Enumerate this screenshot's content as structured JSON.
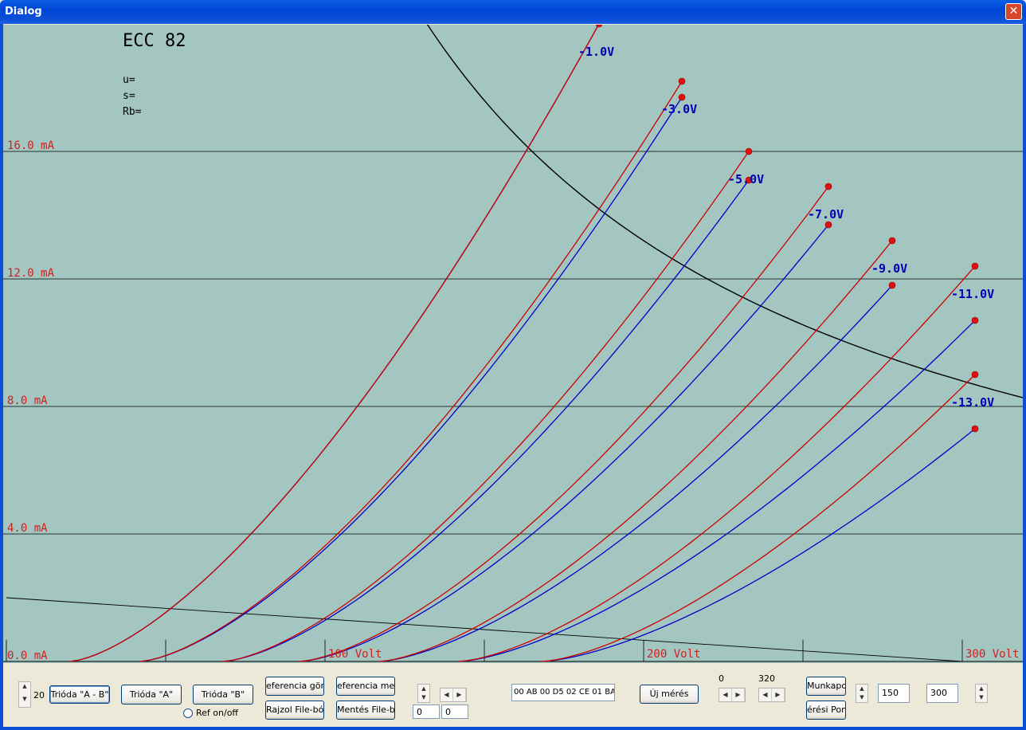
{
  "window": {
    "title": "Dialog",
    "close_glyph": "✕"
  },
  "chart_data": {
    "type": "line",
    "title": "ECC 82",
    "params": [
      "u=",
      "s=",
      "Rb="
    ],
    "xlabel": "",
    "ylabel": "",
    "xlim": [
      0,
      320
    ],
    "ylim": [
      0,
      20
    ],
    "x_ticks": [
      {
        "v": 0,
        "label": ""
      },
      {
        "v": 50,
        "label": ""
      },
      {
        "v": 100,
        "label": "100 Volt"
      },
      {
        "v": 150,
        "label": ""
      },
      {
        "v": 200,
        "label": "200 Volt"
      },
      {
        "v": 250,
        "label": ""
      },
      {
        "v": 300,
        "label": "300 Volt"
      }
    ],
    "y_ticks": [
      {
        "v": 0,
        "label": "0.0 mA"
      },
      {
        "v": 4,
        "label": "4.0 mA"
      },
      {
        "v": 8,
        "label": "8.0 mA"
      },
      {
        "v": 12,
        "label": "12.0 mA"
      },
      {
        "v": 16,
        "label": "16.0 mA"
      }
    ],
    "grid": "horizontal",
    "series_colors": {
      "A": "#cc0000",
      "B": "#0000c8"
    },
    "curves": [
      {
        "grid_label": "-1.0V",
        "start": 20,
        "end": 186,
        "a_end": 20.0,
        "b_end": 20.0
      },
      {
        "grid_label": "-3.0V",
        "start": 42,
        "end": 212,
        "a_end": 18.2,
        "b_end": 17.7
      },
      {
        "grid_label": "-5.0V",
        "start": 68,
        "end": 233,
        "a_end": 16.0,
        "b_end": 15.1
      },
      {
        "grid_label": "-7.0V",
        "start": 92,
        "end": 258,
        "a_end": 14.9,
        "b_end": 13.7
      },
      {
        "grid_label": "-9.0V",
        "start": 117,
        "end": 278,
        "a_end": 13.2,
        "b_end": 11.8
      },
      {
        "grid_label": "-11.0V",
        "start": 142,
        "end": 304,
        "a_end": 12.4,
        "b_end": 10.7
      },
      {
        "grid_label": "-13.0V",
        "start": 168,
        "end": 304,
        "a_end": 9.0,
        "b_end": 7.3
      }
    ],
    "load_line": {
      "from": [
        0,
        2.0
      ],
      "to": [
        300,
        0.0
      ]
    },
    "hyperbola_k": 2640
  },
  "controls": {
    "spin_value": "20",
    "btn_trioda_ab": "Trióda \"A - B\"",
    "btn_trioda_a": "Trióda  \"A\"",
    "btn_trioda_b": "Trióda  \"B\"",
    "ref_radio": "Ref on/off",
    "btn_ref_curve": "eferencia görb",
    "btn_draw_file": "Rajzol File-ból",
    "btn_ref_save": "eferencia mentr",
    "btn_save_file": "Mentés File-ba",
    "field_left_1": "0",
    "field_left_2": "0",
    "hex_data": "00 AB 00 D5 02 CE 01 BA",
    "btn_new_measure": "Új mérés",
    "range_low": "0",
    "range_high": "320",
    "btn_work_point": "Munkapon",
    "btn_measure_point": "érési Pont",
    "field_150": "150",
    "field_300": "300"
  }
}
